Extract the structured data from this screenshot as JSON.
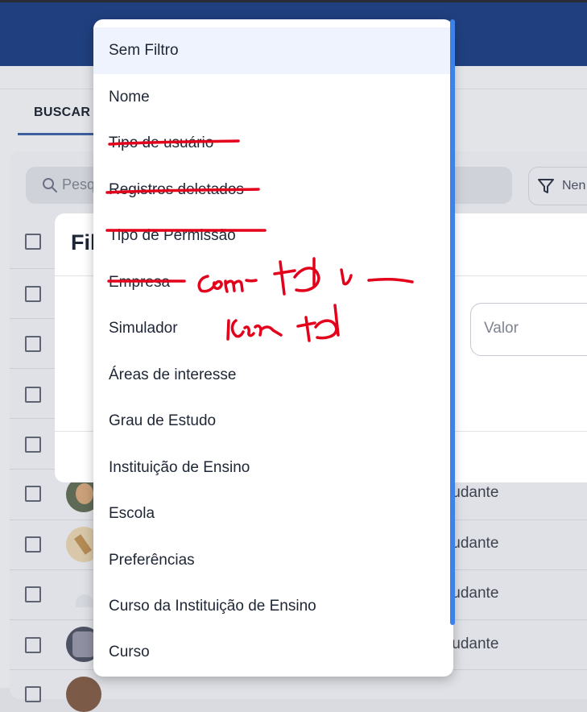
{
  "tabs": {
    "buscar": "BUSCAR"
  },
  "search": {
    "placeholder": "Pesq"
  },
  "filter_button": {
    "label": "Nen"
  },
  "modal": {
    "title": "Fil",
    "valor_placeholder": "Valor"
  },
  "rows": {
    "role_label": "tudante"
  },
  "dropdown": {
    "items": [
      {
        "label": "Sem Filtro",
        "selected": true,
        "struck": false
      },
      {
        "label": "Nome",
        "selected": false,
        "struck": false
      },
      {
        "label": "Tipo de usuário",
        "selected": false,
        "struck": true
      },
      {
        "label": "Registros deletados",
        "selected": false,
        "struck": true
      },
      {
        "label": "Tipo de Permissão",
        "selected": false,
        "struck": true
      },
      {
        "label": "Empresa",
        "selected": false,
        "struck": true
      },
      {
        "label": "Simulador",
        "selected": false,
        "struck": false
      },
      {
        "label": "Áreas de interesse",
        "selected": false,
        "struck": false
      },
      {
        "label": "Grau de Estudo",
        "selected": false,
        "struck": false
      },
      {
        "label": "Instituição de Ensino",
        "selected": false,
        "struck": false
      },
      {
        "label": "Escola",
        "selected": false,
        "struck": false
      },
      {
        "label": "Preferências",
        "selected": false,
        "struck": false
      },
      {
        "label": "Curso da Instituição de Ensino",
        "selected": false,
        "struck": false
      },
      {
        "label": "Curso",
        "selected": false,
        "struck": false
      }
    ]
  },
  "colors": {
    "header": "#203f7e",
    "accent_scrollbar": "#3c82e8",
    "annotation_red": "#e3001b",
    "selected_item_bg": "#eef3fd"
  }
}
